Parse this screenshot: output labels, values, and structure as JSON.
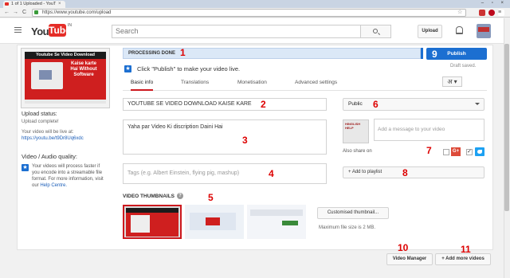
{
  "browser": {
    "tab_title": "1 of 1 Uploaded - YouT",
    "tab_close": "×",
    "window_controls": "– ▫ ×",
    "url": "https://www.youtube.com/upload",
    "back": "←",
    "forward": "→",
    "reload": "C"
  },
  "header": {
    "logo_you": "You",
    "logo_tube": "Tube",
    "logo_region": "IN",
    "search_placeholder": "Search",
    "upload_label": "Upload"
  },
  "sidebar": {
    "thumb_header": "Youtube Se Video Download",
    "thumb_text": "Kaise karte Hai Without Software",
    "upload_status_heading": "Upload status:",
    "upload_status_text": "Upload complete!",
    "live_text": "Your video will be live at:",
    "live_link": "https://youtu.be/t9Dr8Uq6xdc",
    "quality_heading": "Video / Audio quality:",
    "quality_text": "Your videos will process faster if you encode into a streamable file format. For more information, visit our",
    "quality_link": "Help Centre."
  },
  "status": {
    "processing": "PROCESSING DONE",
    "publish_label": "Publish",
    "draft_saved": "Draft saved.",
    "click_publish": "Click \"Publish\" to make your video live."
  },
  "tabs": [
    {
      "label": "Basic info",
      "active": true
    },
    {
      "label": "Translations",
      "active": false
    },
    {
      "label": "Monetisation",
      "active": false
    },
    {
      "label": "Advanced settings",
      "active": false
    }
  ],
  "language_button": "अ ▾",
  "form": {
    "title_value": "YOUTUBE SE VIDEO DOWNLOAD KAISE KARE",
    "description_value": "Yaha par Video Ki discription Daini Hai",
    "tags_placeholder": "Tags (e.g. Albert Einstein, flying pig, mashup)",
    "privacy_value": "Public",
    "share_message_placeholder": "Add a message to your video",
    "share_avatar_text": "HINGLISH HELP",
    "also_share_label": "Also share on",
    "gplus_label": "G+",
    "add_playlist_label": "+ Add to playlist"
  },
  "thumbnails": {
    "label": "VIDEO THUMBNAILS",
    "help": "?",
    "custom_button": "Customised thumbnail...",
    "max_size": "Maximum file size is 2 MB."
  },
  "footer": {
    "video_manager": "Video Manager",
    "add_more": "+ Add more videos"
  },
  "annotations": [
    "1",
    "2",
    "3",
    "4",
    "5",
    "6",
    "7",
    "8",
    "9",
    "10",
    "11"
  ],
  "colors": {
    "accent_blue": "#1c6fd1",
    "brand_red": "#e52d27",
    "annotation_red": "#dd0000"
  }
}
